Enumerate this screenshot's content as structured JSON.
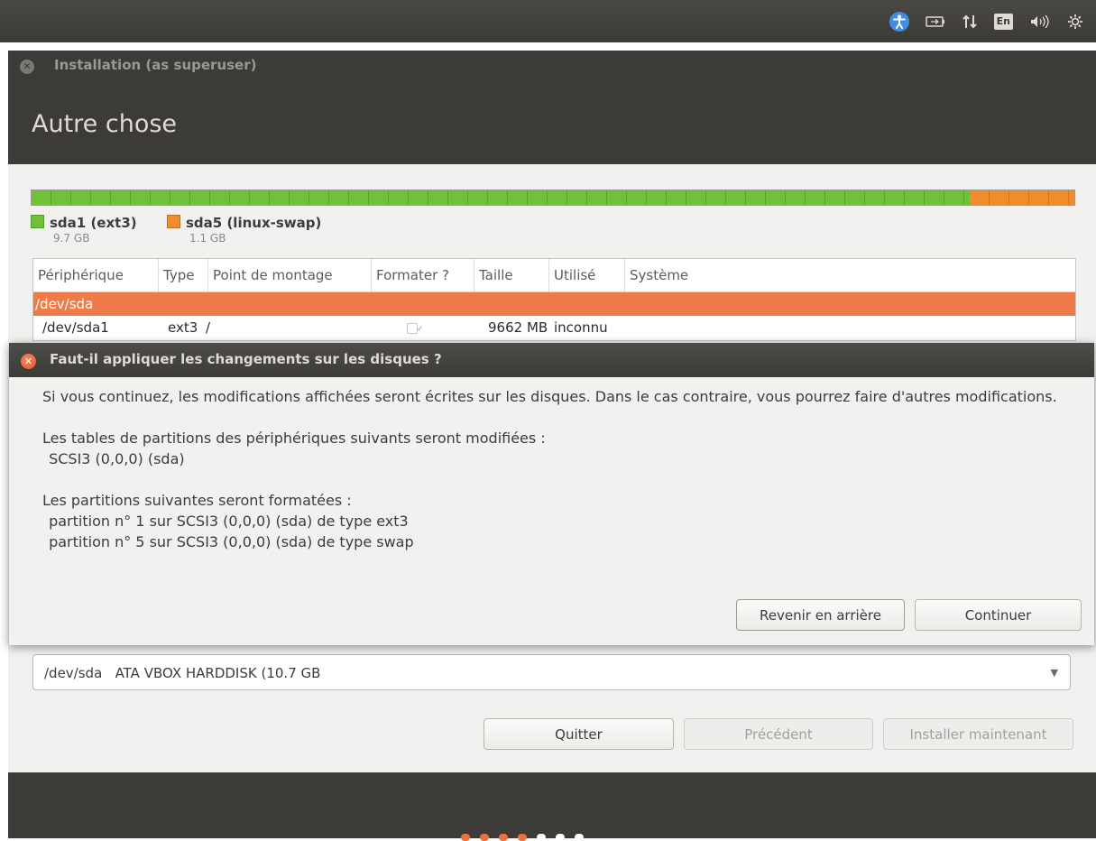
{
  "top_panel": {
    "indicators": [
      {
        "name": "accessibility-icon",
        "glyph": "☥"
      },
      {
        "name": "battery-icon",
        "glyph": "▭"
      },
      {
        "name": "network-icon",
        "glyph": "⇅"
      },
      {
        "name": "keyboard-layout",
        "text": "En"
      },
      {
        "name": "volume-icon",
        "glyph": "◂))"
      },
      {
        "name": "settings-gear-icon",
        "glyph": "⚙"
      }
    ]
  },
  "installer": {
    "window_title": "Installation (as superuser)",
    "page_title": "Autre chose",
    "partition_bar": {
      "segments": [
        {
          "name": "sda1",
          "color": "#6fc238",
          "fraction": 0.9
        },
        {
          "name": "sda5",
          "color": "#f08c2c",
          "fraction": 0.1
        }
      ]
    },
    "legend": [
      {
        "label": "sda1 (ext3)",
        "size": "9.7 GB",
        "color": "#6fc238"
      },
      {
        "label": "sda5 (linux-swap)",
        "size": "1.1 GB",
        "color": "#f08c2c"
      }
    ],
    "table": {
      "columns": [
        "Périphérique",
        "Type",
        "Point de montage",
        "Formater ?",
        "Taille",
        "Utilisé",
        "Système"
      ],
      "device_row": "/dev/sda",
      "rows": [
        {
          "device": "/dev/sda1",
          "type": "ext3",
          "mount": "/",
          "format": "✓",
          "size": "9662 MB",
          "used": "inconnu",
          "system": ""
        }
      ]
    },
    "device_select": {
      "value": "/dev/sda   ATA VBOX HARDDISK (10.7 GB"
    },
    "buttons": {
      "quit": "Quitter",
      "previous": "Précédent",
      "install": "Installer maintenant"
    },
    "progress": {
      "total": 7,
      "completed": 4,
      "done_color": "#e9733f",
      "todo_color": "#ffffff"
    }
  },
  "dialog": {
    "title": "Faut-il appliquer les changements sur les disques ?",
    "paragraph1": "Si vous continuez, les modifications affichées seront écrites sur les disques. Dans le cas contraire, vous pourrez faire d'autres modifications.",
    "paragraph2_heading": "Les tables de partitions des périphériques suivants seront modifiées :",
    "paragraph2_items": [
      " SCSI3 (0,0,0) (sda)"
    ],
    "paragraph3_heading": "Les partitions suivantes seront formatées :",
    "paragraph3_items": [
      " partition n° 1 sur SCSI3 (0,0,0) (sda) de type ext3",
      " partition n° 5 sur SCSI3 (0,0,0) (sda) de type swap"
    ],
    "buttons": {
      "back": "Revenir en arrière",
      "continue": "Continuer"
    }
  }
}
